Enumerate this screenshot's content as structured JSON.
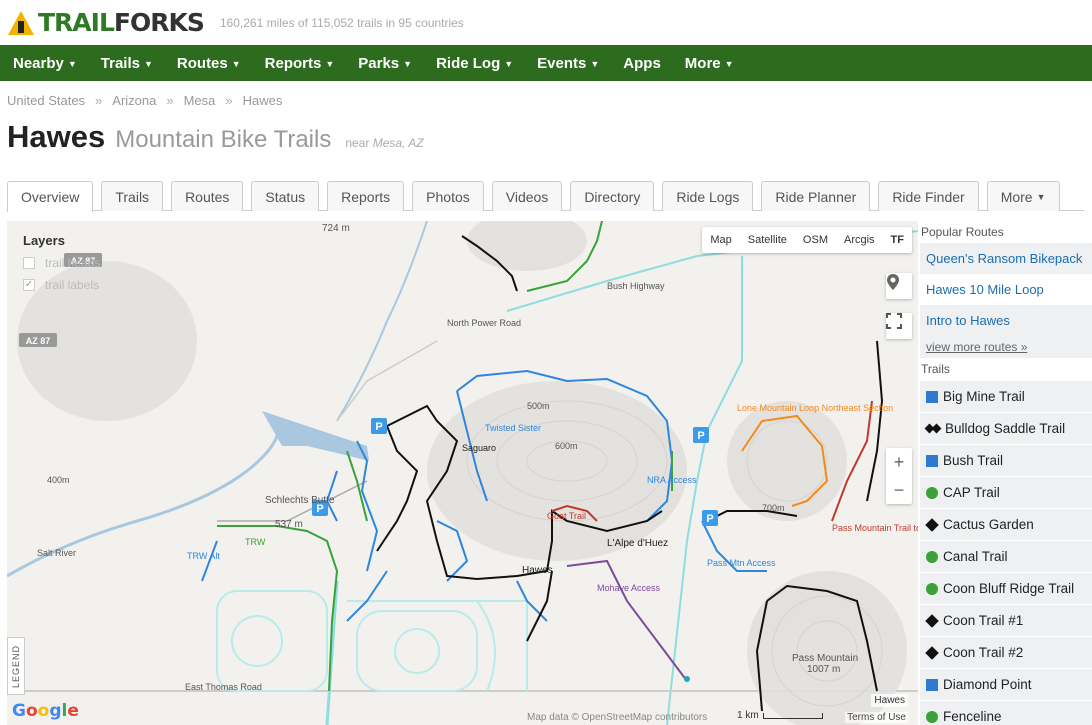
{
  "header": {
    "logo_text_trail": "TRAIL",
    "logo_text_forks": "FORKS",
    "stats": "160,261 miles of 115,052 trails in 95 countries"
  },
  "nav": {
    "items": [
      {
        "label": "Nearby",
        "caret": true
      },
      {
        "label": "Trails",
        "caret": true
      },
      {
        "label": "Routes",
        "caret": true
      },
      {
        "label": "Reports",
        "caret": true
      },
      {
        "label": "Parks",
        "caret": true
      },
      {
        "label": "Ride Log",
        "caret": true
      },
      {
        "label": "Events",
        "caret": true
      },
      {
        "label": "Apps",
        "caret": false
      },
      {
        "label": "More",
        "caret": true
      }
    ]
  },
  "breadcrumb": [
    "United States",
    "Arizona",
    "Mesa",
    "Hawes"
  ],
  "title": {
    "main": "Hawes",
    "sub": "Mountain Bike Trails",
    "near_prefix": "near",
    "near_place": "Mesa, AZ"
  },
  "tabs": [
    "Overview",
    "Trails",
    "Routes",
    "Status",
    "Reports",
    "Photos",
    "Videos",
    "Directory",
    "Ride Logs",
    "Ride Planner",
    "Ride Finder",
    "More"
  ],
  "active_tab": "Overview",
  "map": {
    "layers_title": "Layers",
    "layer_options": [
      {
        "label": "trail heads",
        "checked": false
      },
      {
        "label": "trail labels",
        "checked": true
      }
    ],
    "map_types": [
      "Map",
      "Satellite",
      "OSM",
      "Arcgis",
      "TF"
    ],
    "selected_map_type": "TF",
    "legend_label": "LEGEND",
    "attribution": "Map data © OpenStreetMap contributors",
    "scale_label": "1 km",
    "terms_label": "Terms of Use",
    "location_tag": "Hawes",
    "labels": {
      "bush_highway": "Bush Highway",
      "north_power_road": "North Power Road",
      "east_thomas_road": "East Thomas Road",
      "salt_river": "Salt River",
      "schlechts_butte": "Schlechts Butte",
      "schlechts_elev": "537 m",
      "pass_mountain": "Pass Mountain",
      "pass_mountain_elev": "1007 m",
      "elev_724": "724 m",
      "az87": "AZ 87",
      "lapdhuez": "L'Alpe d'Huez",
      "hawes": "Hawes",
      "trw": "TRW",
      "trw_alt": "TRW Alt",
      "pass_mtn_access": "Pass Mtn Access",
      "lone_mountain_loop": "Lone Mountain Loop Northeast Section",
      "pass_mountain_to_bulldog": "Pass Mountain Trail to Bulldog",
      "goat_trail": "Goat Trail",
      "mohave_access": "Mohave Access",
      "twisted_sister": "Twisted Sister",
      "saguaro": "Saguaro",
      "nra_access": "NRA Access",
      "elev_400": "400m",
      "elev_500": "500m",
      "elev_600": "600m",
      "elev_700": "700m"
    }
  },
  "sidebar": {
    "popular_routes_title": "Popular Routes",
    "routes": [
      "Queen's Ransom Bikepack",
      "Hawes 10 Mile Loop",
      "Intro to Hawes"
    ],
    "view_more": "view more routes »",
    "trails_title": "Trails",
    "trails": [
      {
        "name": "Big Mine Trail",
        "difficulty": "blue"
      },
      {
        "name": "Bulldog Saddle Trail",
        "difficulty": "double-black"
      },
      {
        "name": "Bush Trail",
        "difficulty": "blue"
      },
      {
        "name": "CAP Trail",
        "difficulty": "green"
      },
      {
        "name": "Cactus Garden",
        "difficulty": "black"
      },
      {
        "name": "Canal Trail",
        "difficulty": "green"
      },
      {
        "name": "Coon Bluff Ridge Trail",
        "difficulty": "green"
      },
      {
        "name": "Coon Trail #1",
        "difficulty": "black"
      },
      {
        "name": "Coon Trail #2",
        "difficulty": "black"
      },
      {
        "name": "Diamond Point",
        "difficulty": "blue"
      },
      {
        "name": "Fenceline",
        "difficulty": "green"
      }
    ]
  }
}
